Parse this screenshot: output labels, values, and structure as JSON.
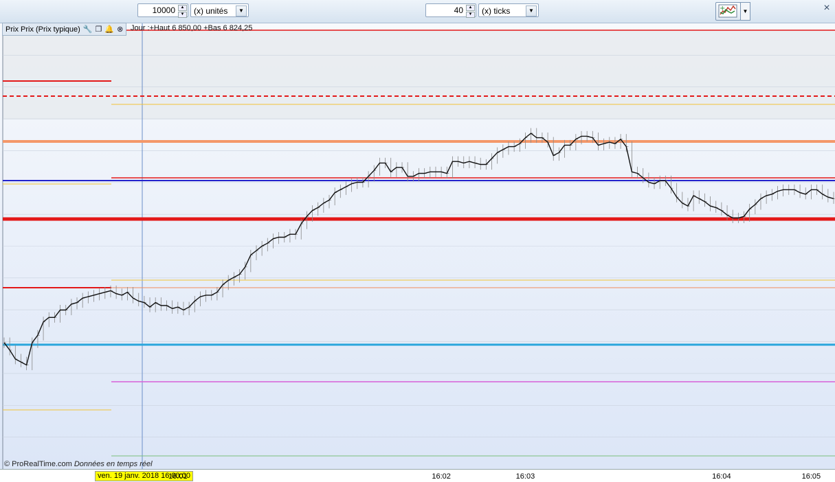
{
  "toolbar": {
    "units_value": "10000",
    "units_label": "(x) unités",
    "ticks_value": "40",
    "ticks_label": "(x) ticks"
  },
  "legend": {
    "title": "Prix Prix (Prix typique)",
    "day_info": "Jour :+Haut 6 850,00 +Bas 6 824,25"
  },
  "watermark": {
    "brand": "© ProRealTime.com",
    "note": "Données en temps réel"
  },
  "xaxis": {
    "date_label": "ven. 19 janv. 2018 16:00:00",
    "ticks": [
      {
        "label": "16:01",
        "index": 31
      },
      {
        "label": "16:02",
        "index": 78
      },
      {
        "label": "16:03",
        "index": 93
      },
      {
        "label": "16:04",
        "index": 128
      },
      {
        "label": "16:05",
        "index": 144
      }
    ]
  },
  "chart_data": {
    "type": "line",
    "title": "Prix Prix (Prix typique)",
    "ylim": [
      6820,
      6850
    ],
    "x_count": 149,
    "series": [
      {
        "name": "Prix typique",
        "values": [
          6828.5,
          6828.0,
          6827.4,
          6827.2,
          6827.0,
          6828.5,
          6829.0,
          6829.9,
          6830.2,
          6830.2,
          6830.7,
          6830.7,
          6831.1,
          6831.2,
          6831.5,
          6831.6,
          6831.7,
          6831.8,
          6831.9,
          6832.0,
          6831.8,
          6831.7,
          6831.9,
          6831.5,
          6831.3,
          6831.2,
          6830.9,
          6831.2,
          6831.0,
          6831.0,
          6830.8,
          6830.9,
          6830.7,
          6830.9,
          6831.3,
          6831.6,
          6831.7,
          6831.7,
          6831.9,
          6832.4,
          6832.7,
          6832.9,
          6833.1,
          6833.6,
          6834.4,
          6834.7,
          6835.0,
          6835.2,
          6835.5,
          6835.6,
          6835.6,
          6835.8,
          6835.8,
          6836.5,
          6837.0,
          6837.4,
          6837.6,
          6837.9,
          6838.1,
          6838.6,
          6838.8,
          6839.0,
          6839.2,
          6839.3,
          6839.3,
          6839.7,
          6840.1,
          6840.6,
          6840.6,
          6840.0,
          6840.3,
          6840.3,
          6839.7,
          6839.7,
          6839.9,
          6839.9,
          6840.0,
          6840.0,
          6840.0,
          6839.9,
          6840.7,
          6840.7,
          6840.6,
          6840.7,
          6840.6,
          6840.5,
          6840.5,
          6840.9,
          6841.3,
          6841.5,
          6841.7,
          6841.7,
          6841.9,
          6842.3,
          6842.6,
          6842.3,
          6842.3,
          6842.0,
          6841.1,
          6841.3,
          6841.8,
          6841.8,
          6842.2,
          6842.4,
          6842.4,
          6842.3,
          6841.8,
          6841.9,
          6842.0,
          6841.9,
          6842.2,
          6841.7,
          6840.0,
          6839.9,
          6839.6,
          6839.3,
          6839.2,
          6839.4,
          6839.4,
          6838.9,
          6838.3,
          6837.9,
          6837.7,
          6838.4,
          6838.2,
          6838.0,
          6837.7,
          6837.6,
          6837.4,
          6837.1,
          6836.9,
          6836.9,
          6837.0,
          6837.5,
          6837.8,
          6838.2,
          6838.4,
          6838.5,
          6838.7,
          6838.8,
          6838.8,
          6838.8,
          6838.6,
          6838.5,
          6838.8,
          6838.8,
          6838.5,
          6838.3,
          6838.2
        ]
      }
    ],
    "reference_lines": [
      {
        "color": "#e31818",
        "style": "solid",
        "weight": "thick"
      },
      {
        "color": "#2aa6dc",
        "style": "solid",
        "weight": "thick"
      },
      {
        "color": "#f4986a",
        "style": "solid",
        "weight": "thick"
      },
      {
        "color": "#e31818",
        "style": "dashed",
        "weight": "medium"
      },
      {
        "color": "#2222cc",
        "style": "solid",
        "weight": "medium"
      },
      {
        "color": "#e31818",
        "style": "solid",
        "weight": "thin"
      },
      {
        "color": "#f2c436",
        "style": "solid",
        "weight": "thin"
      },
      {
        "color": "#f08a5a",
        "style": "solid",
        "weight": "thin"
      },
      {
        "color": "#d860d8",
        "style": "solid",
        "weight": "thin"
      },
      {
        "color": "#7bc07b",
        "style": "solid",
        "weight": "thin"
      }
    ],
    "grid": true
  },
  "colors": {
    "price_line": "#111111",
    "candle_wick": "#888888",
    "background_top": "#f4f6fa",
    "background_bottom": "#dde7f7",
    "axis_date_highlight": "#ffff00"
  }
}
